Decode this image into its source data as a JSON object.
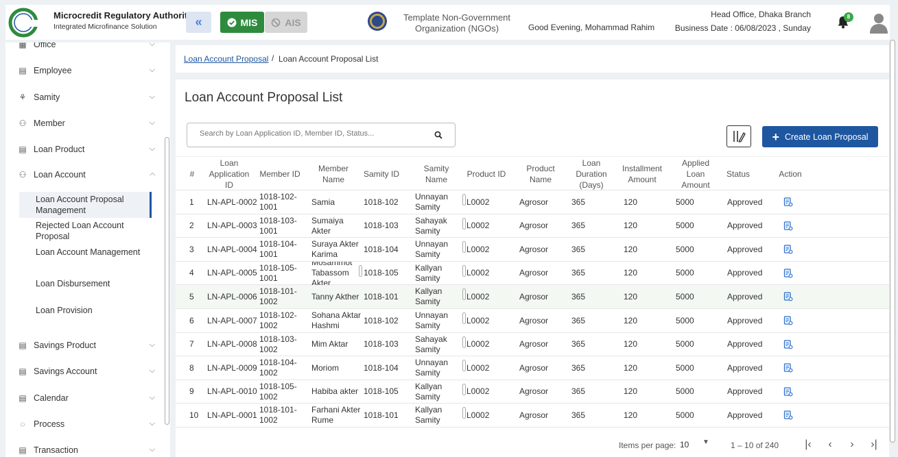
{
  "header": {
    "org_name": "Microcredit Regulatory Authority",
    "org_sub": "Integrated Microfinance Solution",
    "logo_text": "Microcredit Regulatory Authority",
    "mis_label": "MIS",
    "ais_label": "AIS",
    "ngo_name": "Template Non-Government Organization (NGOs)",
    "greeting": "Good Evening, Mohammad Rahim",
    "branch": "Head Office, Dhaka Branch",
    "business_date": "Business Date : 06/08/2023 , Sunday",
    "notification_count": "8"
  },
  "sidebar": {
    "items": [
      {
        "label": "Office",
        "icon": "office-icon"
      },
      {
        "label": "Employee",
        "icon": "employee-icon"
      },
      {
        "label": "Samity",
        "icon": "samity-icon"
      },
      {
        "label": "Member",
        "icon": "member-icon"
      },
      {
        "label": "Loan Product",
        "icon": "loan-product-icon"
      },
      {
        "label": "Loan Account",
        "icon": "loan-account-icon"
      },
      {
        "label": "Savings Product",
        "icon": "savings-product-icon"
      },
      {
        "label": "Savings Account",
        "icon": "savings-account-icon"
      },
      {
        "label": "Calendar",
        "icon": "calendar-icon"
      },
      {
        "label": "Process",
        "icon": "process-icon"
      },
      {
        "label": "Transaction",
        "icon": "transaction-icon"
      }
    ],
    "sub_items": [
      "Loan Account Proposal Management",
      "Rejected Loan Account Proposal",
      "Loan Account Management",
      "Loan Disbursement",
      "Loan Provision"
    ]
  },
  "breadcrumb": {
    "link": "Loan Account Proposal",
    "separator": "/",
    "current": "Loan Account Proposal List"
  },
  "main": {
    "title": "Loan Account Proposal List",
    "search_placeholder": "Search by Loan Application ID, Member ID, Status...",
    "create_label": "Create Loan Proposal"
  },
  "table": {
    "headers": [
      "#",
      "Loan Application ID",
      "Member ID",
      "Member Name",
      "Samity ID",
      "Samity Name",
      "Product ID",
      "Product Name",
      "Loan Duration (Days)",
      "Installment Amount",
      "Applied Loan Amount",
      "Status",
      "Action"
    ],
    "rows": [
      [
        "1",
        "LN-APL-0002",
        "1018-102-1001",
        "Samia",
        "1018-102",
        "Unnayan Samity",
        "L0002",
        "Agrosor",
        "365",
        "120",
        "5000",
        "Approved"
      ],
      [
        "2",
        "LN-APL-0003",
        "1018-103-1001",
        "Sumaiya Akter",
        "1018-103",
        "Sahayak Samity",
        "L0002",
        "Agrosor",
        "365",
        "120",
        "5000",
        "Approved"
      ],
      [
        "3",
        "LN-APL-0004",
        "1018-104-1001",
        "Suraya Akter Karima",
        "1018-104",
        "Unnayan Samity",
        "L0002",
        "Agrosor",
        "365",
        "120",
        "5000",
        "Approved"
      ],
      [
        "4",
        "LN-APL-0005",
        "1018-105-1001",
        "Mosammot Tabassom Akter",
        "1018-105",
        "Kallyan Samity",
        "L0002",
        "Agrosor",
        "365",
        "120",
        "5000",
        "Approved"
      ],
      [
        "5",
        "LN-APL-0006",
        "1018-101-1002",
        "Tanny Akther",
        "1018-101",
        "Kallyan Samity",
        "L0002",
        "Agrosor",
        "365",
        "120",
        "5000",
        "Approved"
      ],
      [
        "6",
        "LN-APL-0007",
        "1018-102-1002",
        "Sohana Aktar Hashmi",
        "1018-102",
        "Unnayan Samity",
        "L0002",
        "Agrosor",
        "365",
        "120",
        "5000",
        "Approved"
      ],
      [
        "7",
        "LN-APL-0008",
        "1018-103-1002",
        "Mim Aktar",
        "1018-103",
        "Sahayak Samity",
        "L0002",
        "Agrosor",
        "365",
        "120",
        "5000",
        "Approved"
      ],
      [
        "8",
        "LN-APL-0009",
        "1018-104-1002",
        "Moriom",
        "1018-104",
        "Unnayan Samity",
        "L0002",
        "Agrosor",
        "365",
        "120",
        "5000",
        "Approved"
      ],
      [
        "9",
        "LN-APL-0010",
        "1018-105-1002",
        "Habiba akter",
        "1018-105",
        "Kallyan Samity",
        "L0002",
        "Agrosor",
        "365",
        "120",
        "5000",
        "Approved"
      ],
      [
        "10",
        "LN-APL-0001",
        "1018-101-1002",
        "Farhani Akter Rume",
        "1018-101",
        "Kallyan Samity",
        "L0002",
        "Agrosor",
        "365",
        "120",
        "5000",
        "Approved"
      ]
    ]
  },
  "pagination": {
    "items_per_page_label": "Items per page:",
    "page_size": "10",
    "range": "1 – 10 of 240"
  },
  "colors": {
    "primary": "#1e56a0",
    "mis_green": "#2e8b3e",
    "badge_green": "#3aa845"
  }
}
